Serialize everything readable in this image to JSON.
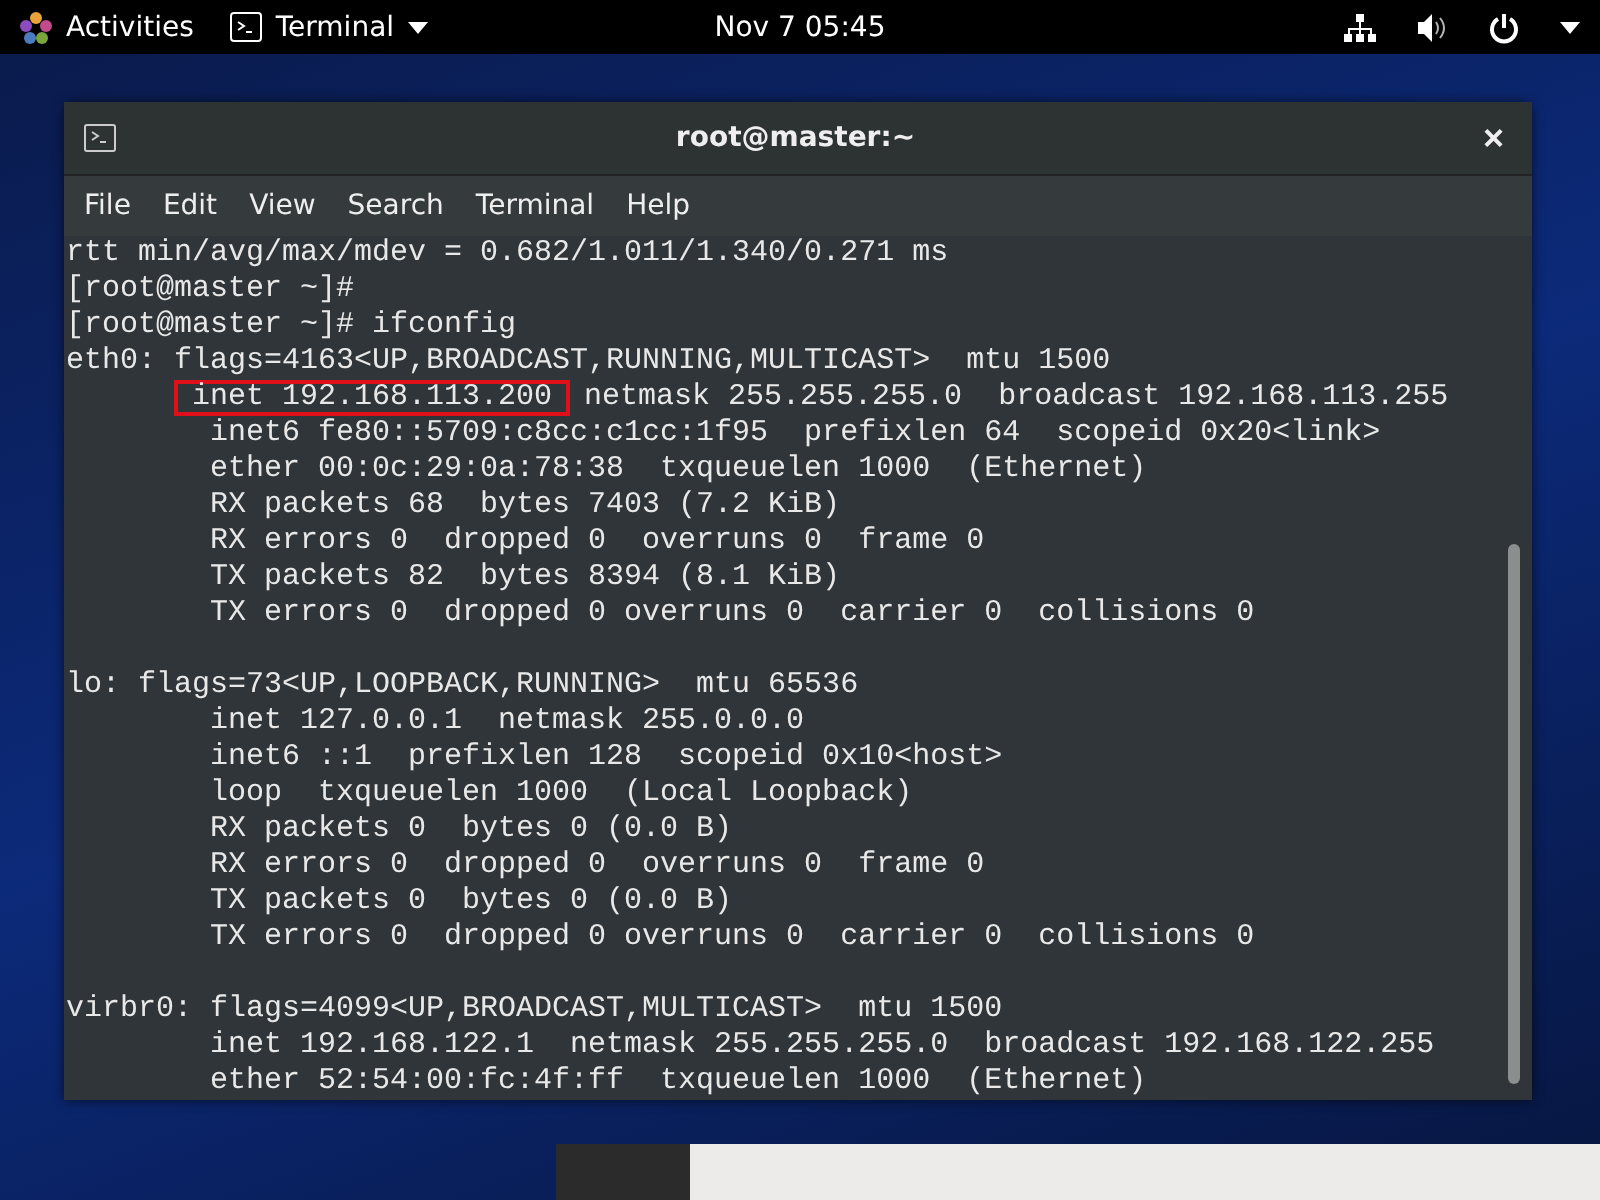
{
  "top_bar": {
    "activities": "Activities",
    "app_menu": "Terminal",
    "clock": "Nov 7  05:45"
  },
  "window": {
    "title": "root@master:~",
    "close": "×"
  },
  "menu": [
    "File",
    "Edit",
    "View",
    "Search",
    "Terminal",
    "Help"
  ],
  "terminal_blocks": [
    [
      "rtt min/avg/max/mdev = 0.682/1.011/1.340/0.271 ms",
      "[root@master ~]#",
      "[root@master ~]# ifconfig",
      "eth0: flags=4163<UP,BROADCAST,RUNNING,MULTICAST>  mtu 1500",
      {
        "kind": "highlighted",
        "marked": "inet 192.168.113.200",
        "rest": "netmask 255.255.255.0  broadcast 192.168.113.255"
      },
      "        inet6 fe80::5709:c8cc:c1cc:1f95  prefixlen 64  scopeid 0x20<link>",
      "        ether 00:0c:29:0a:78:38  txqueuelen 1000  (Ethernet)",
      "        RX packets 68  bytes 7403 (7.2 KiB)",
      "        RX errors 0  dropped 0  overruns 0  frame 0",
      "        TX packets 82  bytes 8394 (8.1 KiB)",
      "        TX errors 0  dropped 0 overruns 0  carrier 0  collisions 0"
    ],
    [
      "lo: flags=73<UP,LOOPBACK,RUNNING>  mtu 65536",
      "        inet 127.0.0.1  netmask 255.0.0.0",
      "        inet6 ::1  prefixlen 128  scopeid 0x10<host>",
      "        loop  txqueuelen 1000  (Local Loopback)",
      "        RX packets 0  bytes 0 (0.0 B)",
      "        RX errors 0  dropped 0  overruns 0  frame 0",
      "        TX packets 0  bytes 0 (0.0 B)",
      "        TX errors 0  dropped 0 overruns 0  carrier 0  collisions 0"
    ],
    [
      "virbr0: flags=4099<UP,BROADCAST,MULTICAST>  mtu 1500",
      "        inet 192.168.122.1  netmask 255.255.255.0  broadcast 192.168.122.255",
      "        ether 52:54:00:fc:4f:ff  txqueuelen 1000  (Ethernet)"
    ]
  ]
}
